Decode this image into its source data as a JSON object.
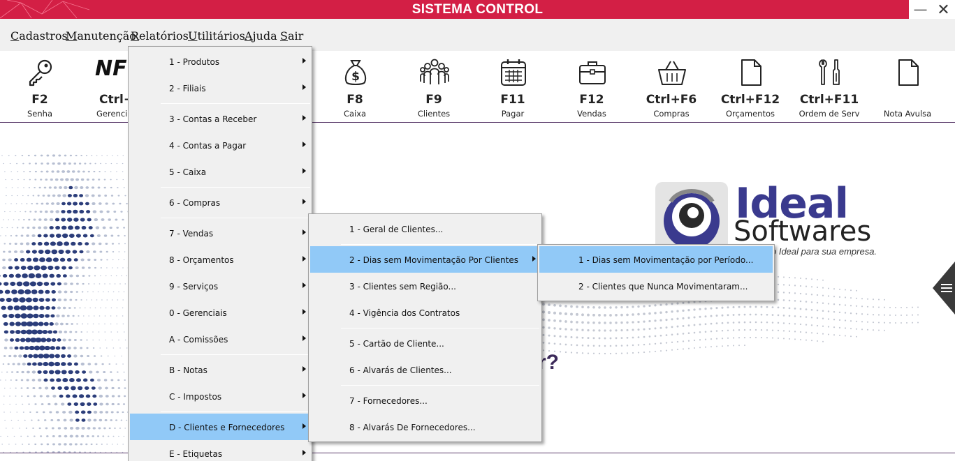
{
  "window": {
    "title": "SISTEMA CONTROL",
    "minimize_glyph": "—",
    "close_glyph": "✕"
  },
  "menubar": {
    "items": [
      {
        "u": "C",
        "rest": "adastros"
      },
      {
        "u": "M",
        "rest": "anutenção"
      },
      {
        "u": "R",
        "rest": "elatórios"
      },
      {
        "u": "U",
        "rest": "tilitários"
      },
      {
        "u": "A",
        "rest": "juda"
      },
      {
        "u": "S",
        "rest": "air"
      }
    ]
  },
  "toolbar": {
    "buttons": [
      {
        "key": "F2",
        "label": "Senha",
        "icon": "key-icon"
      },
      {
        "key": "Ctrl+I",
        "label": "Gerencia",
        "icon": "nfe-icon"
      },
      {
        "key": "F8",
        "label": "Caixa",
        "icon": "money-bag-icon"
      },
      {
        "key": "F9",
        "label": "Clientes",
        "icon": "people-icon"
      },
      {
        "key": "F11",
        "label": "Pagar",
        "icon": "calendar-icon"
      },
      {
        "key": "F12",
        "label": "Vendas",
        "icon": "briefcase-icon"
      },
      {
        "key": "Ctrl+F6",
        "label": "Compras",
        "icon": "basket-icon"
      },
      {
        "key": "Ctrl+F12",
        "label": "Orçamentos",
        "icon": "document-icon"
      },
      {
        "key": "Ctrl+F11",
        "label": "Ordem de Serv",
        "icon": "tools-icon"
      },
      {
        "key": "",
        "label": "Nota Avulsa",
        "icon": "blank-document-icon"
      }
    ],
    "nf_text": "NF"
  },
  "background": {
    "logo_line1": "Ideal",
    "logo_line2": "Softwares",
    "logo_slogan": "o Ideal para sua empresa.",
    "question_fragment": "r?"
  },
  "relatorios_menu": {
    "items": [
      "1 - Produtos",
      "2 - Filiais",
      "3 - Contas a Receber",
      "4 - Contas a Pagar",
      "5 - Caixa",
      "6 - Compras",
      "7 - Vendas",
      "8 - Orçamentos",
      "9 - Serviços",
      "0 - Gerenciais",
      "A - Comissões",
      "B - Notas",
      "C - Impostos",
      "D - Clientes e Fornecedores",
      "E - Etiquetas"
    ],
    "highlighted": "D - Clientes e Fornecedores"
  },
  "clientes_submenu": {
    "items": [
      "1 - Geral de Clientes...",
      "2 - Dias sem Movimentação Por Clientes",
      "3 - Clientes sem Região...",
      "4 - Vigência dos Contratos",
      "5 - Cartão de Cliente...",
      "6 - Alvarás de Clientes...",
      "7 - Fornecedores...",
      "8 - Alvarás De Fornecedores..."
    ],
    "highlighted": "2 - Dias sem Movimentação Por Clientes"
  },
  "dias_submenu": {
    "items": [
      "1 - Dias sem Movimentação por Período...",
      "2 - Clientes que Nunca Movimentaram..."
    ],
    "highlighted": "1 - Dias sem Movimentação por Período..."
  },
  "colors": {
    "titlebar": "#d31f45",
    "menu_highlight": "#91c9f7",
    "logo_blue": "#3a3a8e"
  }
}
